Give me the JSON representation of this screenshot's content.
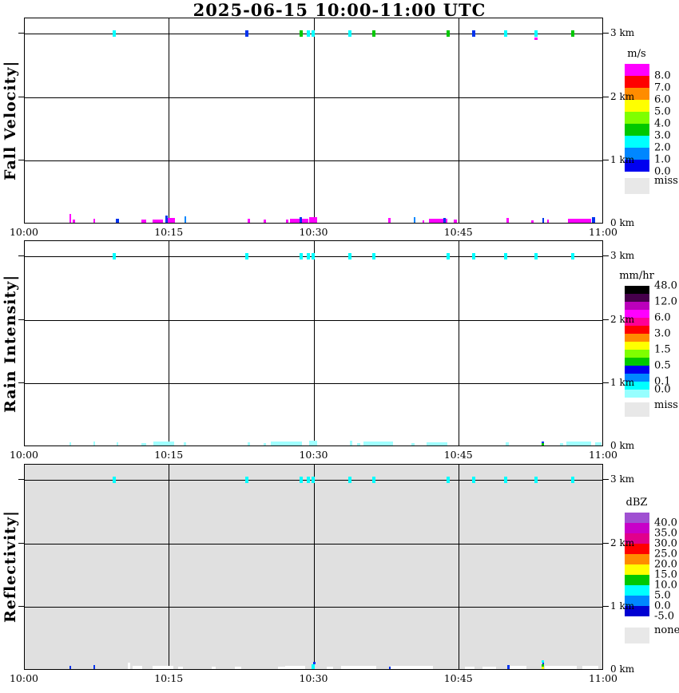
{
  "title": "2025-06-15  10:00-11:00 UTC",
  "time_ticks": [
    "10:00",
    "10:15",
    "10:30",
    "10:45",
    "11:00"
  ],
  "height_ticks": [
    "3 km",
    "2 km",
    "1 km",
    "0 km"
  ],
  "chart_data": [
    {
      "type": "heatmap",
      "title": "Fall Velocity",
      "axis_label": "Fall Velocity|",
      "unit": "m/s",
      "plot_bg": "#ffffff",
      "x_range_utc": [
        "10:00",
        "11:00"
      ],
      "x_ticks": [
        "10:00",
        "10:15",
        "10:30",
        "10:45",
        "11:00"
      ],
      "y_ticks": [
        "0 km",
        "1 km",
        "2 km",
        "3 km"
      ],
      "ylim_km": [
        0,
        3.25
      ],
      "grid": true,
      "colorbar": {
        "title": "m/s",
        "label_pos": "bottom",
        "bands": [
          {
            "color": "#ff00ff",
            "label": "8.0"
          },
          {
            "color": "#ff0000",
            "label": "7.0"
          },
          {
            "color": "#ff8c00",
            "label": "6.0"
          },
          {
            "color": "#ffff00",
            "label": "5.0"
          },
          {
            "color": "#7fff00",
            "label": "4.0"
          },
          {
            "color": "#00c800",
            "label": "3.0"
          },
          {
            "color": "#00ffff",
            "label": "2.0"
          },
          {
            "color": "#0087ff",
            "label": "1.0"
          },
          {
            "color": "#0000f0",
            "label": "0.0"
          }
        ],
        "missing": {
          "color": "#e8e8e8",
          "label": "miss"
        }
      },
      "marks_3km": [
        {
          "t": 9.3,
          "c": "#00ffff"
        },
        {
          "t": 23.0,
          "c": "#0033ee"
        },
        {
          "t": 28.6,
          "c": "#00c800"
        },
        {
          "t": 29.4,
          "c": "#00ffff"
        },
        {
          "t": 29.9,
          "c": "#00ffff"
        },
        {
          "t": 33.7,
          "c": "#00ffff"
        },
        {
          "t": 36.2,
          "c": "#00c800"
        },
        {
          "t": 43.9,
          "c": "#00c800"
        },
        {
          "t": 46.5,
          "c": "#0033ee"
        },
        {
          "t": 49.8,
          "c": "#00ffff"
        },
        {
          "t": 53.0,
          "c": "#00ffff"
        },
        {
          "t": 53.0,
          "c": "#ff00ff",
          "h": 3,
          "dy": 6
        },
        {
          "t": 56.8,
          "c": "#00c800"
        }
      ],
      "marks_surface": [
        {
          "t": 4.7,
          "w": 0.15,
          "h": 11,
          "c": "#ff00ff"
        },
        {
          "t": 5.1,
          "w": 0.3,
          "h": 4,
          "c": "#ff00ff"
        },
        {
          "t": 7.2,
          "w": 0.2,
          "h": 5,
          "c": "#ff00ff"
        },
        {
          "t": 9.6,
          "w": 0.25,
          "h": 5,
          "c": "#0033ee"
        },
        {
          "t": 12.3,
          "w": 0.5,
          "h": 4,
          "c": "#ff00ff"
        },
        {
          "t": 13.8,
          "w": 1.1,
          "h": 4,
          "c": "#ff00ff"
        },
        {
          "t": 14.7,
          "w": 0.2,
          "h": 9,
          "c": "#0033ee"
        },
        {
          "t": 15.2,
          "w": 0.7,
          "h": 6,
          "c": "#ff00ff"
        },
        {
          "t": 16.6,
          "w": 0.15,
          "h": 8,
          "c": "#0087ff"
        },
        {
          "t": 23.2,
          "w": 0.3,
          "h": 5,
          "c": "#ff00ff"
        },
        {
          "t": 24.9,
          "w": 0.25,
          "h": 4,
          "c": "#ff00ff"
        },
        {
          "t": 27.2,
          "w": 0.3,
          "h": 4,
          "c": "#ff00ff"
        },
        {
          "t": 28.4,
          "w": 1.9,
          "h": 5,
          "c": "#ff00ff"
        },
        {
          "t": 28.6,
          "w": 0.2,
          "h": 7,
          "c": "#0033ee"
        },
        {
          "t": 29.9,
          "w": 0.8,
          "h": 7,
          "c": "#ff00ff"
        },
        {
          "t": 37.8,
          "w": 0.25,
          "h": 6,
          "c": "#ff00ff"
        },
        {
          "t": 40.4,
          "w": 0.2,
          "h": 7,
          "c": "#0087ff"
        },
        {
          "t": 41.3,
          "w": 0.2,
          "h": 3,
          "c": "#ff00ff"
        },
        {
          "t": 42.8,
          "w": 1.9,
          "h": 5,
          "c": "#ff00ff"
        },
        {
          "t": 43.5,
          "w": 0.2,
          "h": 6,
          "c": "#0033ee"
        },
        {
          "t": 44.6,
          "w": 0.3,
          "h": 4,
          "c": "#ff00ff"
        },
        {
          "t": 50.0,
          "w": 0.25,
          "h": 6,
          "c": "#ff00ff"
        },
        {
          "t": 52.6,
          "w": 0.2,
          "h": 3,
          "c": "#ff00ff"
        },
        {
          "t": 53.7,
          "w": 0.2,
          "h": 6,
          "c": "#0033ee"
        },
        {
          "t": 54.2,
          "w": 0.2,
          "h": 4,
          "c": "#ff00ff"
        },
        {
          "t": 57.5,
          "w": 2.4,
          "h": 5,
          "c": "#ff00ff"
        },
        {
          "t": 58.9,
          "w": 0.3,
          "h": 7,
          "c": "#0033ee"
        }
      ]
    },
    {
      "type": "heatmap",
      "title": "Rain Intensity",
      "axis_label": "Rain Intensity|",
      "unit": "mm/hr",
      "plot_bg": "#ffffff",
      "x_range_utc": [
        "10:00",
        "11:00"
      ],
      "x_ticks": [
        "10:00",
        "10:15",
        "10:30",
        "10:45",
        "11:00"
      ],
      "y_ticks": [
        "0 km",
        "1 km",
        "2 km",
        "3 km"
      ],
      "ylim_km": [
        0,
        3.25
      ],
      "grid": true,
      "colorbar": {
        "title": "mm/hr",
        "label_pos": "top",
        "bands": [
          {
            "color": "#000000",
            "label": "48.0"
          },
          {
            "color": "#46004b",
            "label": null
          },
          {
            "color": "#bb00bb",
            "label": "12.0"
          },
          {
            "color": "#ff00ff",
            "label": null
          },
          {
            "color": "#ff0096",
            "label": "6.0"
          },
          {
            "color": "#ff0000",
            "label": null
          },
          {
            "color": "#ff8c00",
            "label": "3.0"
          },
          {
            "color": "#ffff00",
            "label": null
          },
          {
            "color": "#7fff00",
            "label": "1.5"
          },
          {
            "color": "#00c800",
            "label": null
          },
          {
            "color": "#0000f0",
            "label": "0.5"
          },
          {
            "color": "#0087ff",
            "label": null
          },
          {
            "color": "#00ffff",
            "label": "0.1"
          },
          {
            "color": "#96ffff",
            "label": "0.0"
          }
        ],
        "missing": {
          "color": "#e8e8e8",
          "label": "miss"
        }
      },
      "marks_3km": [
        {
          "t": 9.3,
          "c": "#00ffff"
        },
        {
          "t": 23.0,
          "c": "#00ffff"
        },
        {
          "t": 28.6,
          "c": "#00ffff"
        },
        {
          "t": 29.4,
          "c": "#00ffff"
        },
        {
          "t": 29.9,
          "c": "#00ffff"
        },
        {
          "t": 33.7,
          "c": "#00ffff"
        },
        {
          "t": 36.2,
          "c": "#00ffff"
        },
        {
          "t": 43.9,
          "c": "#00ffff"
        },
        {
          "t": 46.5,
          "c": "#00ffff"
        },
        {
          "t": 49.8,
          "c": "#00ffff"
        },
        {
          "t": 53.0,
          "c": "#00ffff"
        },
        {
          "t": 56.8,
          "c": "#00ffff"
        }
      ],
      "marks_surface": [
        {
          "t": 4.7,
          "w": 0.2,
          "h": 4,
          "c": "#a0ffff"
        },
        {
          "t": 7.2,
          "w": 0.2,
          "h": 5,
          "c": "#a0ffff"
        },
        {
          "t": 9.6,
          "w": 0.2,
          "h": 4,
          "c": "#a0ffff"
        },
        {
          "t": 12.3,
          "w": 0.5,
          "h": 3,
          "c": "#a0ffff"
        },
        {
          "t": 13.7,
          "w": 0.4,
          "h": 5,
          "c": "#a0ffff"
        },
        {
          "t": 14.4,
          "w": 2.2,
          "h": 5,
          "c": "#a0ffff"
        },
        {
          "t": 16.6,
          "w": 0.2,
          "h": 4,
          "c": "#a0ffff"
        },
        {
          "t": 23.2,
          "w": 0.3,
          "h": 4,
          "c": "#a0ffff"
        },
        {
          "t": 24.9,
          "w": 0.25,
          "h": 3,
          "c": "#a0ffff"
        },
        {
          "t": 27.1,
          "w": 3.3,
          "h": 5,
          "c": "#a0ffff"
        },
        {
          "t": 29.9,
          "w": 0.8,
          "h": 6,
          "c": "#a0ffff"
        },
        {
          "t": 33.8,
          "w": 0.3,
          "h": 6,
          "c": "#a0ffff"
        },
        {
          "t": 34.6,
          "w": 0.3,
          "h": 3,
          "c": "#a0ffff"
        },
        {
          "t": 35.6,
          "w": 0.5,
          "h": 3,
          "c": "#a0ffff"
        },
        {
          "t": 36.6,
          "w": 3.1,
          "h": 5,
          "c": "#a0ffff"
        },
        {
          "t": 40.2,
          "w": 0.3,
          "h": 3,
          "c": "#a0ffff"
        },
        {
          "t": 42.7,
          "w": 2.1,
          "h": 4,
          "c": "#a0ffff"
        },
        {
          "t": 50.0,
          "w": 0.3,
          "h": 4,
          "c": "#a0ffff"
        },
        {
          "t": 53.7,
          "w": 0.25,
          "h": 3,
          "c": "#00c800"
        },
        {
          "t": 53.7,
          "w": 0.25,
          "h": 2,
          "c": "#0033ee",
          "lift": 3
        },
        {
          "t": 55.6,
          "w": 0.3,
          "h": 3,
          "c": "#a0ffff"
        },
        {
          "t": 57.4,
          "w": 2.6,
          "h": 5,
          "c": "#a0ffff"
        },
        {
          "t": 59.4,
          "w": 0.7,
          "h": 4,
          "c": "#a0ffff"
        }
      ]
    },
    {
      "type": "heatmap",
      "title": "Reflectivity",
      "axis_label": "Reflectivity|",
      "unit": "dBZ",
      "plot_bg": "#e0e0e0",
      "x_range_utc": [
        "10:00",
        "11:00"
      ],
      "x_ticks": [
        "10:00",
        "10:15",
        "10:30",
        "10:45",
        "11:00"
      ],
      "y_ticks": [
        "0 km",
        "1 km",
        "2 km",
        "3 km"
      ],
      "ylim_km": [
        0,
        3.25
      ],
      "grid": true,
      "colorbar": {
        "title": "dBZ",
        "label_pos": "bottom",
        "bands": [
          {
            "color": "#a050d2",
            "label": "40.0"
          },
          {
            "color": "#c800c8",
            "label": "35.0"
          },
          {
            "color": "#e1008c",
            "label": "30.0"
          },
          {
            "color": "#ff0000",
            "label": "25.0"
          },
          {
            "color": "#ff8c00",
            "label": "20.0"
          },
          {
            "color": "#ffff00",
            "label": "15.0"
          },
          {
            "color": "#00c800",
            "label": "10.0"
          },
          {
            "color": "#00ffff",
            "label": "5.0"
          },
          {
            "color": "#0087ff",
            "label": "0.0"
          },
          {
            "color": "#0000d2",
            "label": "-5.0"
          }
        ],
        "missing": {
          "color": "#e8e8e8",
          "label": "none"
        }
      },
      "marks_3km": [
        {
          "t": 9.3,
          "c": "#00ffff"
        },
        {
          "t": 23.0,
          "c": "#00ffff"
        },
        {
          "t": 28.6,
          "c": "#00ffff"
        },
        {
          "t": 29.4,
          "c": "#00ffff"
        },
        {
          "t": 29.9,
          "c": "#00ffff"
        },
        {
          "t": 33.7,
          "c": "#00ffff"
        },
        {
          "t": 36.2,
          "c": "#00ffff"
        },
        {
          "t": 43.9,
          "c": "#00ffff"
        },
        {
          "t": 46.5,
          "c": "#00ffff"
        },
        {
          "t": 49.8,
          "c": "#00ffff"
        },
        {
          "t": 53.0,
          "c": "#00ffff"
        },
        {
          "t": 56.8,
          "c": "#00ffff"
        }
      ],
      "marks_surface": [
        {
          "t": 4.7,
          "w": 0.2,
          "h": 4,
          "c": "#0033ee"
        },
        {
          "t": 7.2,
          "w": 0.2,
          "h": 5,
          "c": "#0033ee"
        },
        {
          "t": 10.8,
          "w": 0.25,
          "h": 8,
          "c": "#ffffff"
        },
        {
          "t": 11.7,
          "w": 1.0,
          "h": 4,
          "c": "#ffffff"
        },
        {
          "t": 13.6,
          "w": 0.7,
          "h": 4,
          "c": "#ffffff"
        },
        {
          "t": 14.5,
          "w": 1.8,
          "h": 4,
          "c": "#ffffff"
        },
        {
          "t": 16.1,
          "w": 0.5,
          "h": 3,
          "c": "#ffffff"
        },
        {
          "t": 19.6,
          "w": 0.4,
          "h": 3,
          "c": "#ffffff"
        },
        {
          "t": 22.1,
          "w": 0.6,
          "h": 3,
          "c": "#ffffff"
        },
        {
          "t": 26.6,
          "w": 0.8,
          "h": 3,
          "c": "#ffffff"
        },
        {
          "t": 28.0,
          "w": 2.1,
          "h": 4,
          "c": "#ffffff"
        },
        {
          "t": 29.9,
          "w": 0.3,
          "h": 6,
          "c": "#00ffff"
        },
        {
          "t": 30.0,
          "w": 0.2,
          "h": 3,
          "c": "#0033ee",
          "lift": 6
        },
        {
          "t": 31.6,
          "w": 0.7,
          "h": 3,
          "c": "#ffffff"
        },
        {
          "t": 33.6,
          "w": 1.6,
          "h": 4,
          "c": "#ffffff"
        },
        {
          "t": 35.2,
          "w": 2.4,
          "h": 4,
          "c": "#ffffff"
        },
        {
          "t": 37.8,
          "w": 0.2,
          "h": 3,
          "c": "#0033ee"
        },
        {
          "t": 38.6,
          "w": 1.4,
          "h": 4,
          "c": "#ffffff"
        },
        {
          "t": 40.1,
          "w": 4.4,
          "h": 4,
          "c": "#ffffff"
        },
        {
          "t": 46.1,
          "w": 1.0,
          "h": 3,
          "c": "#ffffff"
        },
        {
          "t": 48.1,
          "w": 1.4,
          "h": 3,
          "c": "#ffffff"
        },
        {
          "t": 50.1,
          "w": 0.2,
          "h": 5,
          "c": "#0033ee"
        },
        {
          "t": 51.1,
          "w": 1.7,
          "h": 4,
          "c": "#ffffff"
        },
        {
          "t": 53.7,
          "w": 0.25,
          "h": 3,
          "c": "#ffff00"
        },
        {
          "t": 53.7,
          "w": 0.25,
          "h": 3,
          "c": "#00c800",
          "lift": 3
        },
        {
          "t": 53.7,
          "w": 0.2,
          "h": 2,
          "c": "#0033ee",
          "lift": 6
        },
        {
          "t": 53.7,
          "w": 0.25,
          "h": 3,
          "c": "#00ffff",
          "lift": 8
        },
        {
          "t": 54.6,
          "w": 1.4,
          "h": 4,
          "c": "#ffffff"
        },
        {
          "t": 56.2,
          "w": 2.0,
          "h": 4,
          "c": "#ffffff"
        },
        {
          "t": 58.6,
          "w": 1.6,
          "h": 4,
          "c": "#ffffff"
        }
      ]
    }
  ]
}
